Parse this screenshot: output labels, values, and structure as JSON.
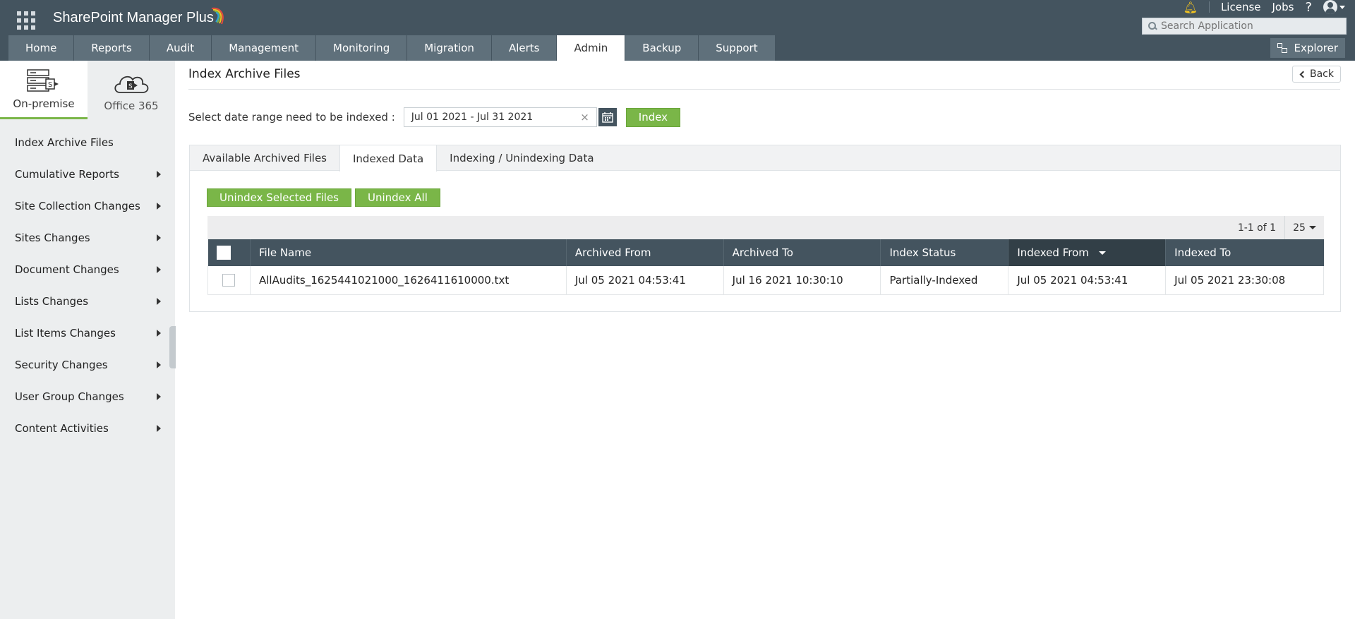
{
  "app": {
    "title": "SharePoint Manager Plus",
    "colors": {
      "header": "#44545f",
      "nav_tab": "#5f707b",
      "accent_green": "#7ab648",
      "bell": "#f2c31f"
    }
  },
  "topbar": {
    "license": "License",
    "jobs": "Jobs",
    "help": "?",
    "search_placeholder": "Search Application",
    "explorer": "Explorer"
  },
  "nav": {
    "tabs": [
      {
        "label": "Home"
      },
      {
        "label": "Reports"
      },
      {
        "label": "Audit"
      },
      {
        "label": "Management"
      },
      {
        "label": "Monitoring"
      },
      {
        "label": "Migration"
      },
      {
        "label": "Alerts"
      },
      {
        "label": "Admin",
        "active": true
      },
      {
        "label": "Backup"
      },
      {
        "label": "Support"
      }
    ]
  },
  "sidebar": {
    "switch": [
      {
        "label": "On-premise",
        "icon": "server-icon",
        "active": true
      },
      {
        "label": "Office 365",
        "icon": "cloud-icon"
      }
    ],
    "items": [
      {
        "label": "Index Archive Files",
        "has_submenu": false
      },
      {
        "label": "Cumulative Reports",
        "has_submenu": true
      },
      {
        "label": "Site Collection Changes",
        "has_submenu": true
      },
      {
        "label": "Sites Changes",
        "has_submenu": true
      },
      {
        "label": "Document Changes",
        "has_submenu": true
      },
      {
        "label": "Lists Changes",
        "has_submenu": true
      },
      {
        "label": "List Items Changes",
        "has_submenu": true
      },
      {
        "label": "Security Changes",
        "has_submenu": true
      },
      {
        "label": "User Group Changes",
        "has_submenu": true
      },
      {
        "label": "Content Activities",
        "has_submenu": true
      }
    ]
  },
  "main": {
    "page_title": "Index Archive Files",
    "back": "Back",
    "date_label": "Select date range need to be indexed :",
    "date_value": "Jul 01 2021 - Jul 31 2021",
    "clear": "×",
    "index_button": "Index",
    "tabs": [
      {
        "label": "Available Archived Files"
      },
      {
        "label": "Indexed Data",
        "active": true
      },
      {
        "label": "Indexing / Unindexing Data"
      }
    ],
    "actions": {
      "unindex_selected": "Unindex Selected Files",
      "unindex_all": "Unindex All"
    },
    "pager": {
      "count": "1-1 of 1",
      "page_size": "25"
    },
    "table": {
      "columns": [
        "File Name",
        "Archived From",
        "Archived To",
        "Index Status",
        "Indexed From",
        "Indexed To"
      ],
      "rows": [
        [
          "AllAudits_1625441021000_1626411610000.txt",
          "Jul 05 2021 04:53:41",
          "Jul 16 2021 10:30:10",
          "Partially-Indexed",
          "Jul 05 2021 04:53:41",
          "Jul 05 2021 23:30:08"
        ]
      ]
    }
  }
}
